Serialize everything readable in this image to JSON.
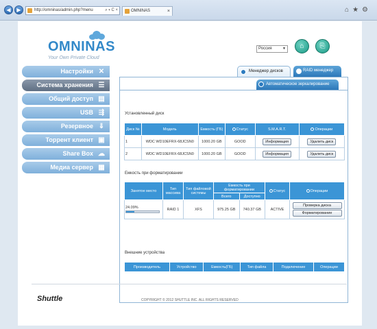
{
  "browser": {
    "address": "http://omninas/admin.php?menu",
    "address_tools": "⌕ ▾ C ×",
    "tab_title": "OMNINAS",
    "tab_close": "×",
    "nav_back": "◀",
    "nav_forward": "▶",
    "icons": [
      "home-icon",
      "star-icon",
      "gear-icon"
    ]
  },
  "header": {
    "logo": "OMNINAS",
    "tagline": "Your Own Private Cloud",
    "language": "Россия",
    "home_icon": "home-icon",
    "logout_icon": "logout-icon"
  },
  "sidebar": {
    "items": [
      {
        "label": "Настройки",
        "icon": "tools-icon"
      },
      {
        "label": "Система хранения",
        "icon": "storage-icon"
      },
      {
        "label": "Общий доступ",
        "icon": "folders-icon"
      },
      {
        "label": "USB",
        "icon": "usb-icon"
      },
      {
        "label": "Резервное",
        "icon": "backup-icon"
      },
      {
        "label": "Торрент клиент",
        "icon": "torrent-icon"
      },
      {
        "label": "Share Box",
        "icon": "sharebox-icon"
      },
      {
        "label": "Медиа сервер",
        "icon": "media-icon"
      }
    ]
  },
  "tabs": {
    "disk_manager": "Менеджер дисков",
    "raid_manager": "RAID менеджер",
    "auto_mirroring": "Автоматическое зеркалирование"
  },
  "installed": {
    "title": "Установленный диск",
    "headers": [
      "Диск №",
      "Модель",
      "Емкость (ГБ)",
      "Статус",
      "S.M.A.R.T.",
      "Операции"
    ],
    "rows": [
      {
        "num": "1",
        "model": "WDC WD10EFRX-68JCSN0",
        "capacity": "1000.20 GB",
        "status": "GOOD",
        "smart_btn": "Информация",
        "op_btn": "Удалить диск"
      },
      {
        "num": "2",
        "model": "WDC WD10EFRX-68JCSN0",
        "capacity": "1000.20 GB",
        "status": "GOOD",
        "smart_btn": "Информация",
        "op_btn": "Удалить диск"
      }
    ]
  },
  "formatted": {
    "title": "Емкость при форматировании",
    "headers": [
      "Занятое место",
      "Тип массива",
      "Тип файловой системы",
      "Емкость при форматировании",
      "Статус",
      "Операции"
    ],
    "subheaders": [
      "Всего",
      "Доступно"
    ],
    "row": {
      "used_pct": "24.09%",
      "used_fraction": 0.2409,
      "array_type": "RAID 1",
      "fs": "XFS",
      "total": "975.25 GB",
      "available": "740.37 GB",
      "status": "ACTIVE",
      "check_btn": "Проверка диска",
      "format_btn": "Форматирование"
    }
  },
  "external": {
    "title": "Внешние устройства",
    "headers": [
      "Производитель",
      "Устройство",
      "Емкость(ГБ)",
      "Тип файла",
      "Подключение",
      "Операции"
    ]
  },
  "footer": {
    "brand": "Shuttle",
    "copyright": "COPYRIGHT © 2012 SHUTTLE INC. ALL RIGHTS RESERVED"
  }
}
